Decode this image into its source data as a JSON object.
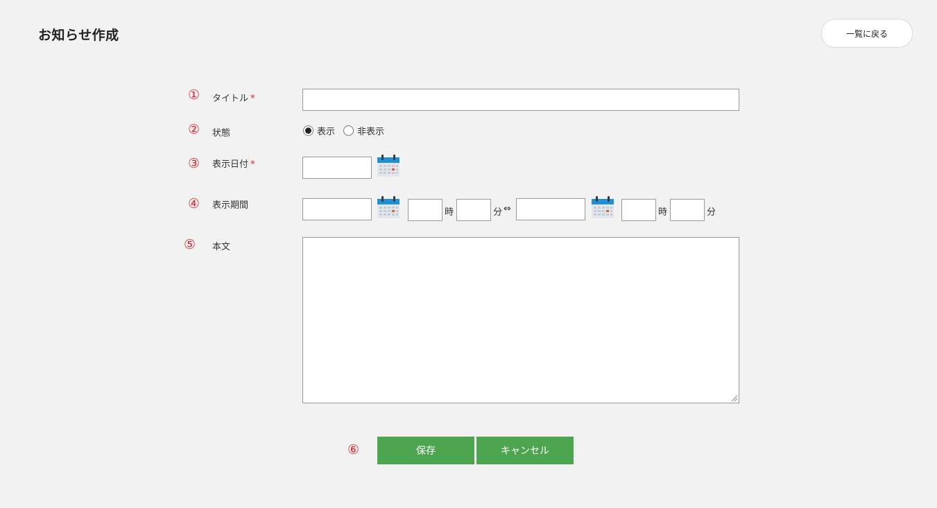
{
  "header": {
    "title": "お知らせ作成",
    "back_label": "一覧に戻る"
  },
  "markers": [
    "①",
    "②",
    "③",
    "④",
    "⑤",
    "⑥"
  ],
  "fields": {
    "title": {
      "label": "タイトル",
      "required_mark": "*",
      "value": ""
    },
    "status": {
      "label": "状態",
      "options": [
        {
          "label": "表示",
          "selected": true
        },
        {
          "label": "非表示",
          "selected": false
        }
      ]
    },
    "display_date": {
      "label": "表示日付",
      "required_mark": "*",
      "value": ""
    },
    "display_period": {
      "label": "表示期間",
      "start_date": "",
      "start_hour": "",
      "start_minute": "",
      "end_date": "",
      "end_hour": "",
      "end_minute": "",
      "hour_unit": "時",
      "minute_unit": "分",
      "range_separator": "⇔"
    },
    "body": {
      "label": "本文",
      "value": ""
    }
  },
  "actions": {
    "save_label": "保存",
    "cancel_label": "キャンセル"
  },
  "colors": {
    "background": "#f2f2f2",
    "marker_red": "#e0242b",
    "button_green": "#4da64f",
    "calendar_blue": "#1f8fd6"
  },
  "icons": {
    "calendar": "calendar-icon"
  }
}
